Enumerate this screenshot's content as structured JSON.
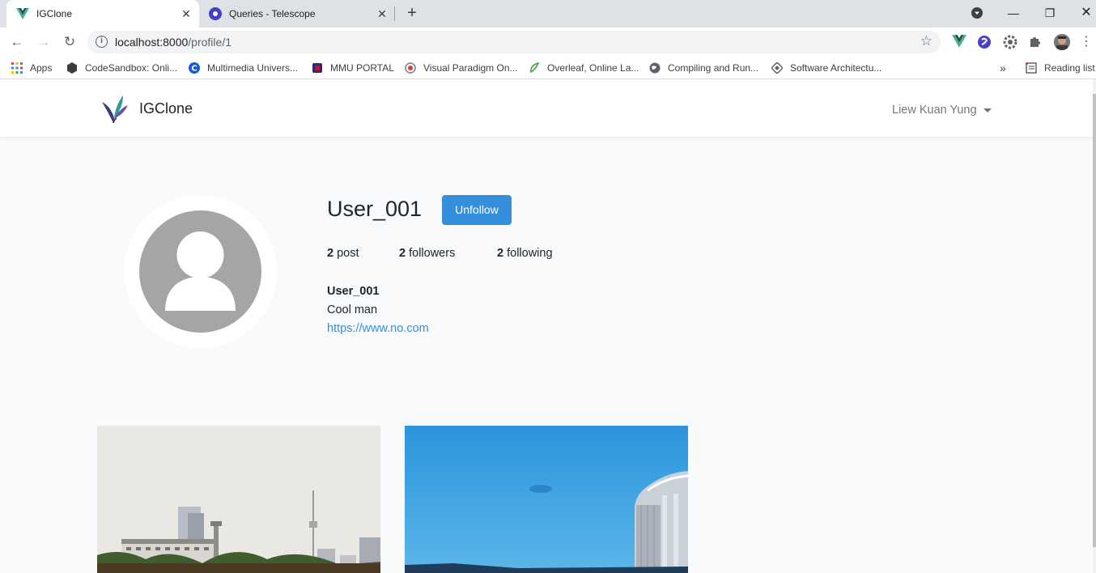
{
  "browser": {
    "tabs": [
      {
        "title": "IGClone",
        "active": true,
        "icon": "vue-icon"
      },
      {
        "title": "Queries - Telescope",
        "active": false,
        "icon": "telescope-icon"
      }
    ],
    "address": {
      "host": "localhost:8000",
      "path": "/profile/1"
    },
    "bookmarks": [
      {
        "label": "Apps",
        "icon": "apps-grid-icon"
      },
      {
        "label": "CodeSandbox: Onli...",
        "icon": "codesandbox-icon"
      },
      {
        "label": "Multimedia Univers...",
        "icon": "c-logo-icon"
      },
      {
        "label": "MMU PORTAL",
        "icon": "mmu-icon"
      },
      {
        "label": "Visual Paradigm On...",
        "icon": "visual-paradigm-icon"
      },
      {
        "label": "Overleaf, Online La...",
        "icon": "overleaf-icon"
      },
      {
        "label": "Compiling and Run...",
        "icon": "globe-icon"
      },
      {
        "label": "Software Architectu...",
        "icon": "diamond-icon"
      }
    ],
    "reading_list": "Reading list",
    "more_bookmarks": "»"
  },
  "site": {
    "brand": "IGClone",
    "user_menu": "Liew Kuan Yung"
  },
  "profile": {
    "username": "User_001",
    "follow_button": "Unfollow",
    "stats": {
      "posts_count": "2",
      "posts_label": "post",
      "followers_count": "2",
      "followers_label": "followers",
      "following_count": "2",
      "following_label": "following"
    },
    "bio": {
      "title": "User_001",
      "description": "Cool man",
      "url": "https://www.no.com"
    }
  },
  "posts": [
    {
      "alt": "city skyline photo"
    },
    {
      "alt": "blue sky building photo"
    }
  ],
  "colors": {
    "primary": "#3490dc",
    "page_bg": "#f8fafc",
    "avatar_gray": "#a5a5a5"
  }
}
